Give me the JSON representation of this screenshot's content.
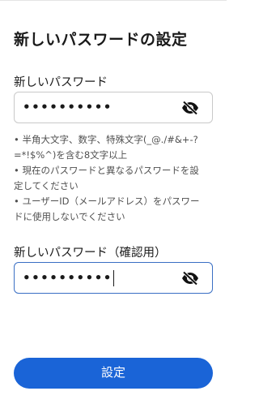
{
  "page": {
    "title": "新しいパスワードの設定"
  },
  "new_password": {
    "label": "新しいパスワード",
    "value_masked": "••••••••••",
    "visibility_icon": "eye-off-icon"
  },
  "rules": [
    "• 半角大文字、数字、特殊文字(_@./#&+-?\n=*!$%^)を含む8文字以上",
    "• 現在のパスワードと異なるパスワードを設\n定してください",
    "• ユーザーID（メールアドレス）をパスワー\nドに使用しないでください"
  ],
  "confirm_password": {
    "label": "新しいパスワード（確認用）",
    "value_masked": "••••••••••",
    "visibility_icon": "eye-off-icon"
  },
  "submit": {
    "label": "設定"
  },
  "colors": {
    "accent": "#1a64d7",
    "focus_border": "#3a6fc4"
  }
}
